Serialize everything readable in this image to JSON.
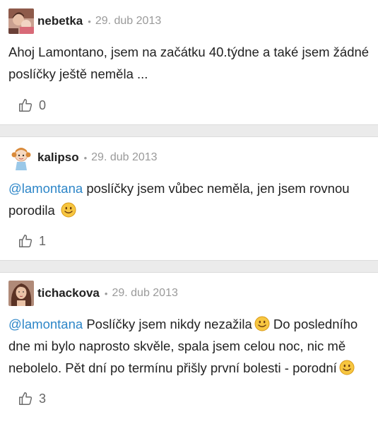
{
  "comments": [
    {
      "author": "nebetka",
      "date": "29. dub 2013",
      "text": "Ahoj Lamontano, jsem na začátku 40.týdne a také jsem žádné poslíčky ještě neměla ...",
      "likes": "0"
    },
    {
      "author": "kalipso",
      "date": "29. dub 2013",
      "mention": "@lamontana",
      "text": " poslíčky jsem vůbec neměla, jen jsem rovnou porodila",
      "smiley": "smiley-emoji",
      "likes": "1"
    },
    {
      "author": "tichackova",
      "date": "29. dub 2013",
      "mention": "@lamontana",
      "text_a": " Poslíčky jsem nikdy nezažila",
      "text_b": " Do posledního dne mi bylo naprosto skvěle, spala jsem celou noc, nic mě nebolelo. Pět dní po termínu přišly první bolesti - porodní",
      "smiley": "smiley-emoji",
      "likes": "3"
    }
  ],
  "separator": "•",
  "icons": {
    "like": "thumbs-up-icon"
  },
  "colors": {
    "mention": "#2d86c8",
    "meta": "#9a9a9a",
    "separator": "#ebebeb"
  }
}
